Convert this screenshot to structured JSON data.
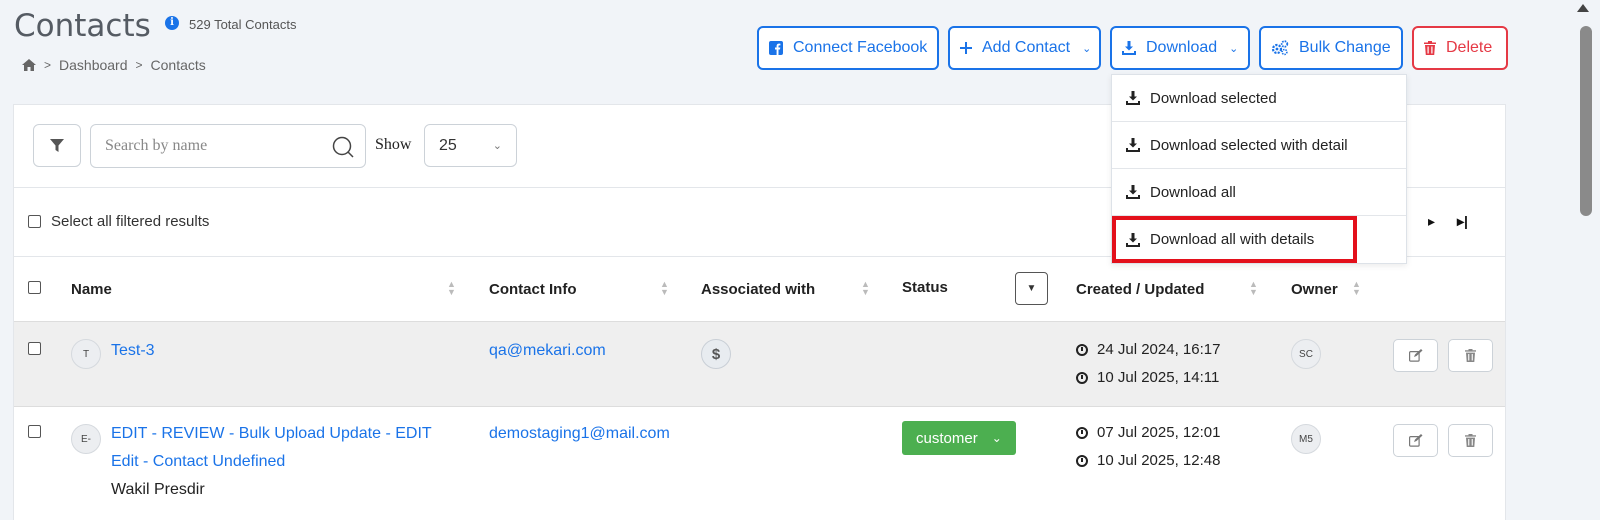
{
  "header": {
    "title": "Contacts",
    "total": "529 Total Contacts",
    "breadcrumb": [
      "Dashboard",
      "Contacts"
    ]
  },
  "actions": {
    "connect_facebook": "Connect Facebook",
    "add_contact": "Add Contact",
    "download": "Download",
    "bulk_change": "Bulk Change",
    "delete": "Delete"
  },
  "download_menu": [
    "Download selected",
    "Download selected with detail",
    "Download all",
    "Download all with details"
  ],
  "toolbar": {
    "search_placeholder": "Search by name",
    "show_label": "Show",
    "show_value": "25",
    "select_all": "Select all filtered results"
  },
  "table": {
    "headers": [
      "Name",
      "Contact Info",
      "Associated with",
      "Status",
      "Created / Updated",
      "Owner"
    ],
    "rows": [
      {
        "avatar": "T",
        "name": "Test-3",
        "email": "qa@mekari.com",
        "created": "24 Jul 2024, 16:17",
        "updated": "10 Jul 2025, 14:11",
        "owner": "SC"
      },
      {
        "avatar": "E-",
        "name_line1": "EDIT - REVIEW - Bulk Upload Update - EDIT",
        "name_line2": "Edit - Contact Undefined",
        "subtitle": "Wakil Presdir",
        "email": "demostaging1@mail.com",
        "status": "customer",
        "created": "07 Jul 2025, 12:01",
        "updated": "10 Jul 2025, 12:48",
        "owner": "M5"
      }
    ]
  },
  "colors": {
    "primary": "#1a73e8",
    "danger": "#e53945",
    "success": "#4caf50",
    "highlight": "#e3101b"
  }
}
